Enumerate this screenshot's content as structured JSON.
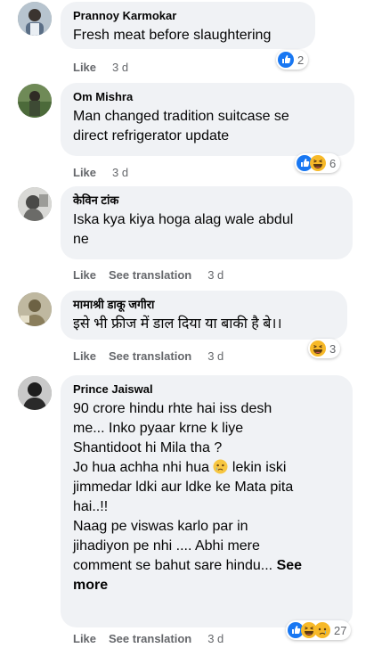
{
  "comments": [
    {
      "author": "Prannoy Karmokar",
      "text": "Fresh meat before slaughtering",
      "actions": [
        "Like"
      ],
      "time": "3 d",
      "reaction_count": "2",
      "reaction_icons": [
        "like-icon"
      ]
    },
    {
      "author": "Om Mishra",
      "text_lines": [
        "Man changed tradition suitcase se",
        "direct refrigerator update"
      ],
      "actions": [
        "Like"
      ],
      "time": "3 d",
      "reaction_count": "6",
      "reaction_icons": [
        "like-icon",
        "haha-icon"
      ]
    },
    {
      "author": "केविन टांक",
      "text_lines": [
        "Iska kya kiya hoga alag wale abdul",
        "ne"
      ],
      "actions": [
        "Like",
        "See translation"
      ],
      "time": "3 d"
    },
    {
      "author": "मामाश्री डाकू जगीरा",
      "text": "इसे भी फ्रीज में डाल दिया या बाकी है बे।।",
      "actions": [
        "Like",
        "See translation"
      ],
      "time": "3 d",
      "reaction_count": "3",
      "reaction_icons": [
        "haha-icon"
      ]
    },
    {
      "author": "Prince Jaiswal",
      "text_lines": [
        "90 crore hindu rhte hai iss desh",
        "me... Inko pyaar krne k liye",
        "Shantidoot hi Mila tha ?",
        "Jo hua achha nhi hua",
        "lekin iski",
        "jimmedar ldki aur ldke ke Mata pita",
        "hai..!!",
        "Naag pe viswas karlo par in",
        "jihadiyon pe nhi .... Abhi mere",
        "comment se bahut sare hindu...",
        "See",
        "more"
      ],
      "emoji_icon": "crying-face-icon",
      "actions": [
        "Like",
        "See translation"
      ],
      "time": "3 d",
      "reaction_count": "27",
      "reaction_icons": [
        "like-icon",
        "haha-icon",
        "sad-icon"
      ]
    }
  ],
  "colors": {
    "bubble": "#f0f2f5",
    "meta": "#65676b",
    "like_blue": "#1877f2",
    "haha_yellow": "#f7b928"
  }
}
